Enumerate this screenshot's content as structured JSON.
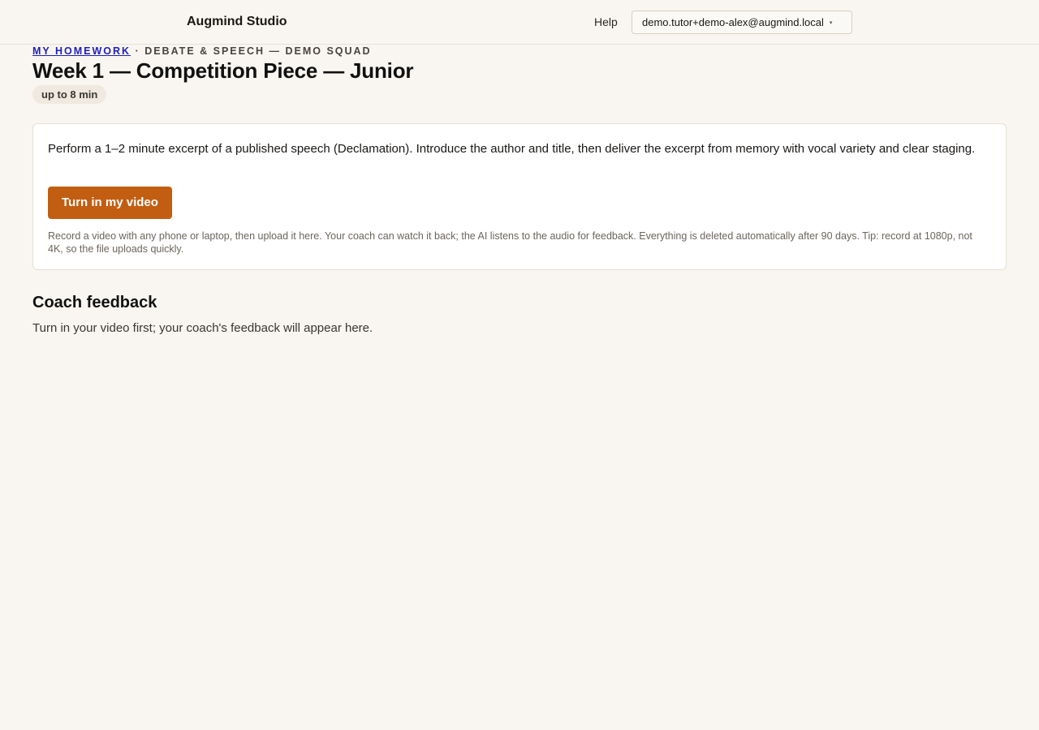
{
  "header": {
    "brand": "Augmind Studio",
    "help_label": "Help",
    "account_email": "demo.tutor+demo-alex@augmind.local",
    "account_caret": "▾"
  },
  "breadcrumb": {
    "link_label": "MY HOMEWORK",
    "separator": " · ",
    "group_label": "DEBATE & SPEECH — DEMO SQUAD"
  },
  "assignment": {
    "title": "Week 1 — Competition Piece — Junior",
    "duration_badge": "up to 8 min",
    "prompt": "Perform a 1–2 minute excerpt of a published speech (Declamation). Introduce the author and title, then deliver the excerpt from memory with vocal variety and clear staging.",
    "submit_label": "Turn in my video",
    "upload_help": "Record a video with any phone or laptop, then upload it here. Your coach can watch it back; the AI listens to the audio for feedback. Everything is deleted automatically after 90 days. Tip: record at 1080p, not 4K, so the file uploads quickly."
  },
  "feedback": {
    "heading": "Coach feedback",
    "empty_message": "Turn in your video first; your coach's feedback will appear here."
  },
  "colors": {
    "page_background": "#f9f6f1",
    "accent_button": "#c25e12",
    "link": "#1f1fb8"
  }
}
